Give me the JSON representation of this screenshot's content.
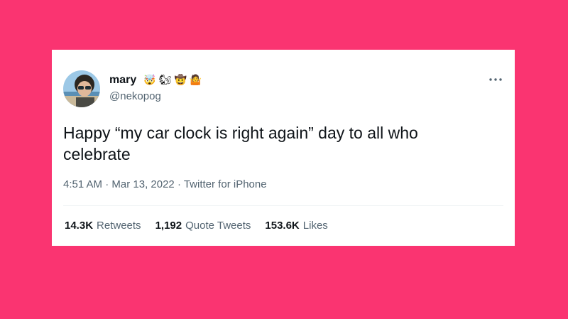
{
  "background_color": "#fa3471",
  "tweet": {
    "author": {
      "display_name": "mary",
      "name_emojis": [
        "🤯",
        "🐿",
        "🤠",
        "🤷"
      ],
      "handle": "@nekopog",
      "avatar_icon": "avatar-photo"
    },
    "more_icon": "more-dots-icon",
    "text": "Happy “my car clock is right again” day to all who celebrate",
    "meta": {
      "time": "4:51 AM",
      "separator": " · ",
      "date": "Mar 13, 2022",
      "source": "Twitter for iPhone"
    },
    "stats": {
      "retweets_count": "14.3K",
      "retweets_label": "Retweets",
      "quotes_count": "1,192",
      "quotes_label": "Quote Tweets",
      "likes_count": "153.6K",
      "likes_label": "Likes"
    }
  }
}
